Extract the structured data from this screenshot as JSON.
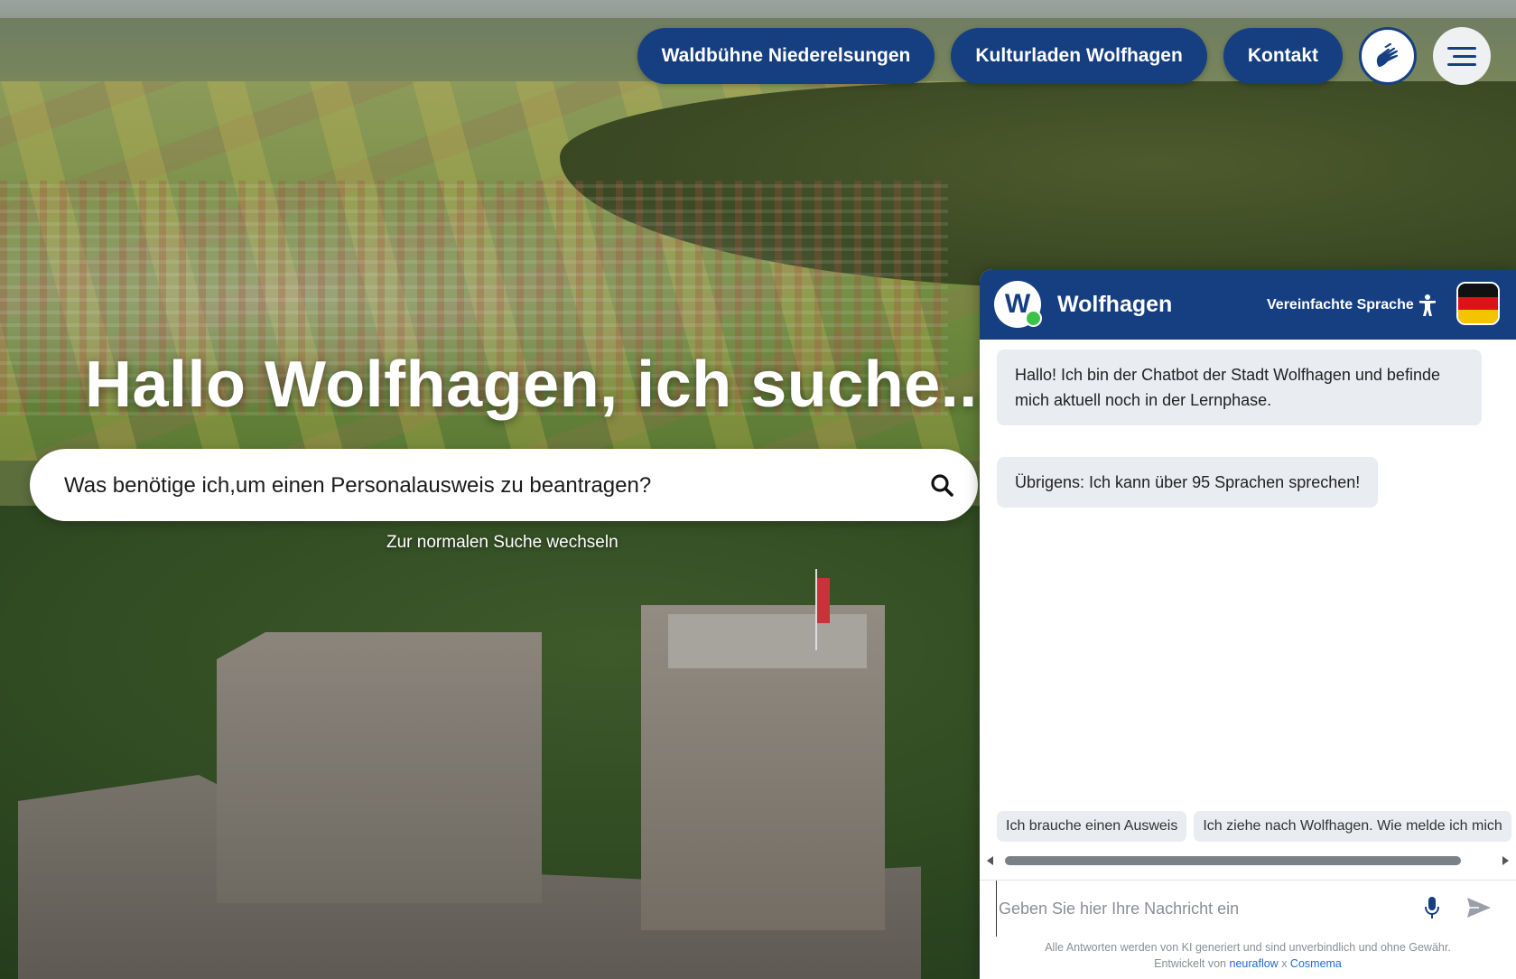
{
  "nav": {
    "items": [
      {
        "label": "Waldbühne Niederelsungen"
      },
      {
        "label": "Kulturladen Wolfhagen"
      },
      {
        "label": "Kontakt"
      }
    ],
    "sign_language_icon": "sign-language-hands-icon",
    "menu_icon": "hamburger-menu-icon",
    "accent_color": "#163f82"
  },
  "hero": {
    "title": "Hallo Wolfhagen, ich suche...",
    "search_value": "Was benötige ich,um einen Personalausweis zu beantragen?",
    "search_icon": "search-icon",
    "switch_link": "Zur normalen Suche wechseln"
  },
  "chat": {
    "title": "Wolfhagen",
    "logo_letter": "W",
    "simple_language": "Vereinfachte Sprache",
    "simple_language_icon": "accessibility-person-icon",
    "language_flag": "german-flag-icon",
    "messages": [
      {
        "text": "Hallo! Ich bin der Chatbot der Stadt Wolfhagen und befinde mich aktuell noch in der Lernphase."
      },
      {
        "text": "Übrigens: Ich kann über 95 Sprachen sprechen!"
      }
    ],
    "quick_replies": [
      {
        "label": "Ich brauche einen Ausweis"
      },
      {
        "label": "Ich ziehe nach Wolfhagen. Wie melde ich mich"
      }
    ],
    "input_placeholder": "Geben Sie hier Ihre Nachricht ein",
    "disclaimer_line1": "Alle Antworten werden von KI generiert und sind unverbindlich und ohne Gewähr.",
    "disclaimer_prefix": "Entwickelt von",
    "disclaimer_link1": "neuraflow",
    "disclaimer_sep": "x",
    "disclaimer_link2": "Cosmema",
    "header_color": "#163f82",
    "bubble_color": "#e9ecf1"
  }
}
